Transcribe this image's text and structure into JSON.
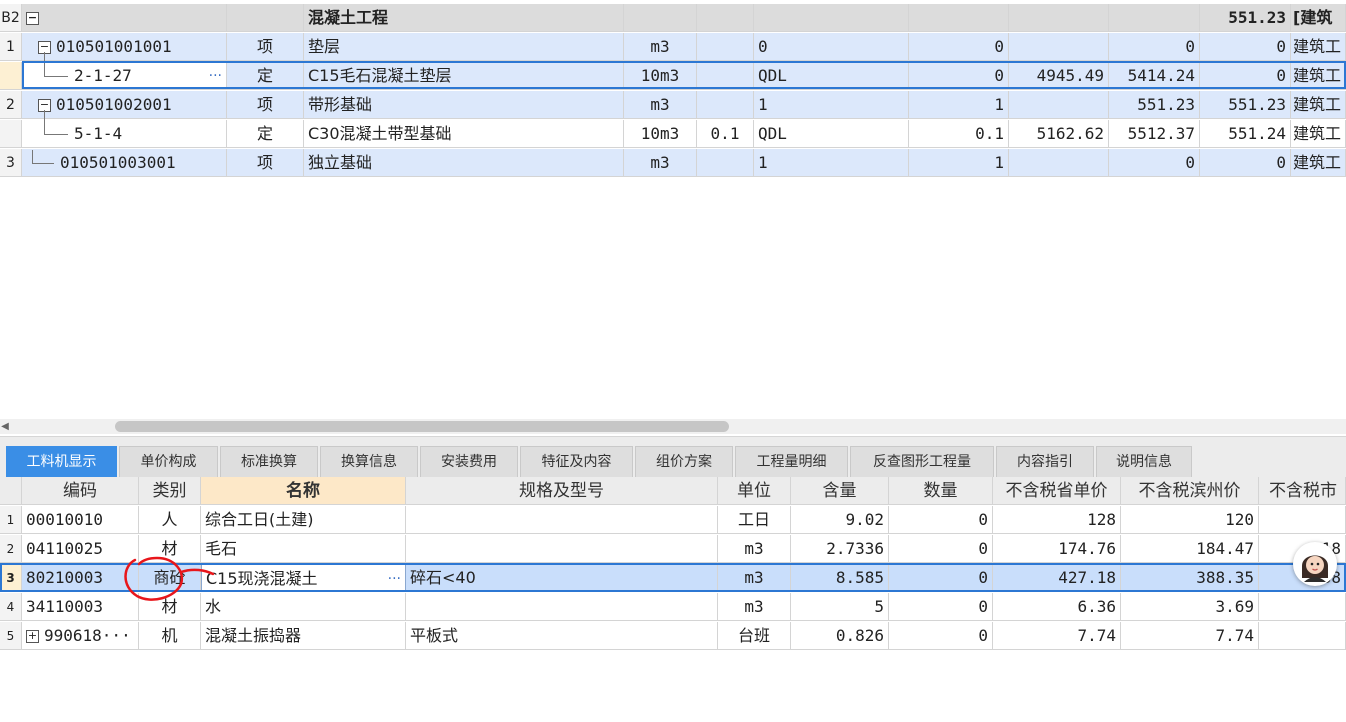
{
  "top_table": {
    "rows": [
      {
        "no": "B2",
        "toggle": "−",
        "code": "",
        "type": "",
        "name": "混凝土工程",
        "unit": "",
        "qty_expr": "",
        "qty_code": "",
        "qty": "",
        "price": "",
        "total_unit": "",
        "total": "551.23",
        "spec": "[建筑"
      },
      {
        "no": "1",
        "toggle": "−",
        "code": "010501001001",
        "type": "项",
        "name": "垫层",
        "unit": "m3",
        "qty_expr": "",
        "qty_code": "0",
        "qty": "0",
        "price": "",
        "total_unit": "0",
        "total": "0",
        "spec": "建筑工"
      },
      {
        "no": "",
        "toggle": "",
        "code": "2-1-27",
        "dots": "···",
        "type": "定",
        "name": "C15毛石混凝土垫层",
        "unit": "10m3",
        "qty_expr": "",
        "qty_code": "QDL",
        "qty": "0",
        "price": "4945.49",
        "total_unit": "5414.24",
        "total": "0",
        "spec": "建筑工"
      },
      {
        "no": "2",
        "toggle": "−",
        "code": "010501002001",
        "type": "项",
        "name": "带形基础",
        "unit": "m3",
        "qty_expr": "",
        "qty_code": "1",
        "qty": "1",
        "price": "",
        "total_unit": "551.23",
        "total": "551.23",
        "spec": "建筑工"
      },
      {
        "no": "",
        "toggle": "",
        "code": "5-1-4",
        "type": "定",
        "name": "C30混凝土带型基础",
        "unit": "10m3",
        "qty_expr": "0.1",
        "qty_code": "QDL",
        "qty": "0.1",
        "price": "5162.62",
        "total_unit": "5512.37",
        "total": "551.24",
        "spec": "建筑工"
      },
      {
        "no": "3",
        "toggle": "",
        "code": "010501003001",
        "type": "项",
        "name": "独立基础",
        "unit": "m3",
        "qty_expr": "",
        "qty_code": "1",
        "qty": "1",
        "price": "",
        "total_unit": "0",
        "total": "0",
        "spec": "建筑工"
      }
    ]
  },
  "tabs": [
    "工料机显示",
    "单价构成",
    "标准换算",
    "换算信息",
    "安装费用",
    "特征及内容",
    "组价方案",
    "工程量明细",
    "反查图形工程量",
    "内容指引",
    "说明信息"
  ],
  "bottom_table": {
    "headers": {
      "code": "编码",
      "cat": "类别",
      "name": "名称",
      "spec": "规格及型号",
      "unit": "单位",
      "content": "含量",
      "qty": "数量",
      "p1": "不含税省单价",
      "p2": "不含税滨州价",
      "p3": "不含税市"
    },
    "rows": [
      {
        "no": "1",
        "code": "00010010",
        "cat": "人",
        "name": "综合工日(土建)",
        "spec": "",
        "unit": "工日",
        "content": "9.02",
        "qty": "0",
        "p1": "128",
        "p2": "120",
        "p3": ""
      },
      {
        "no": "2",
        "code": "04110025",
        "cat": "材",
        "name": "毛石",
        "spec": "",
        "unit": "m3",
        "content": "2.7336",
        "qty": "0",
        "p1": "174.76",
        "p2": "184.47",
        "p3": "18"
      },
      {
        "no": "3",
        "code": "80210003",
        "cat": "商砼",
        "name": "C15现浇混凝土",
        "dots": "···",
        "spec": "碎石<40",
        "unit": "m3",
        "content": "8.585",
        "qty": "0",
        "p1": "427.18",
        "p2": "388.35",
        "p3": "38"
      },
      {
        "no": "4",
        "code": "34110003",
        "cat": "材",
        "name": "水",
        "spec": "",
        "unit": "m3",
        "content": "5",
        "qty": "0",
        "p1": "6.36",
        "p2": "3.69",
        "p3": ""
      },
      {
        "no": "5",
        "toggle": "+",
        "code": "990618···",
        "cat": "机",
        "name": "混凝土振捣器",
        "spec": "平板式",
        "unit": "台班",
        "content": "0.826",
        "qty": "0",
        "p1": "7.74",
        "p2": "7.74",
        "p3": ""
      }
    ]
  },
  "colors": {
    "accent": "#3a8ee6",
    "selection_border": "#2c77d3",
    "row_blue": "#dce8fb",
    "annotation_red": "#e8161b"
  },
  "icons": [
    "expand-collapse-icon",
    "more-dots-icon",
    "assistant-avatar-icon",
    "scroll-left-arrow-icon"
  ]
}
